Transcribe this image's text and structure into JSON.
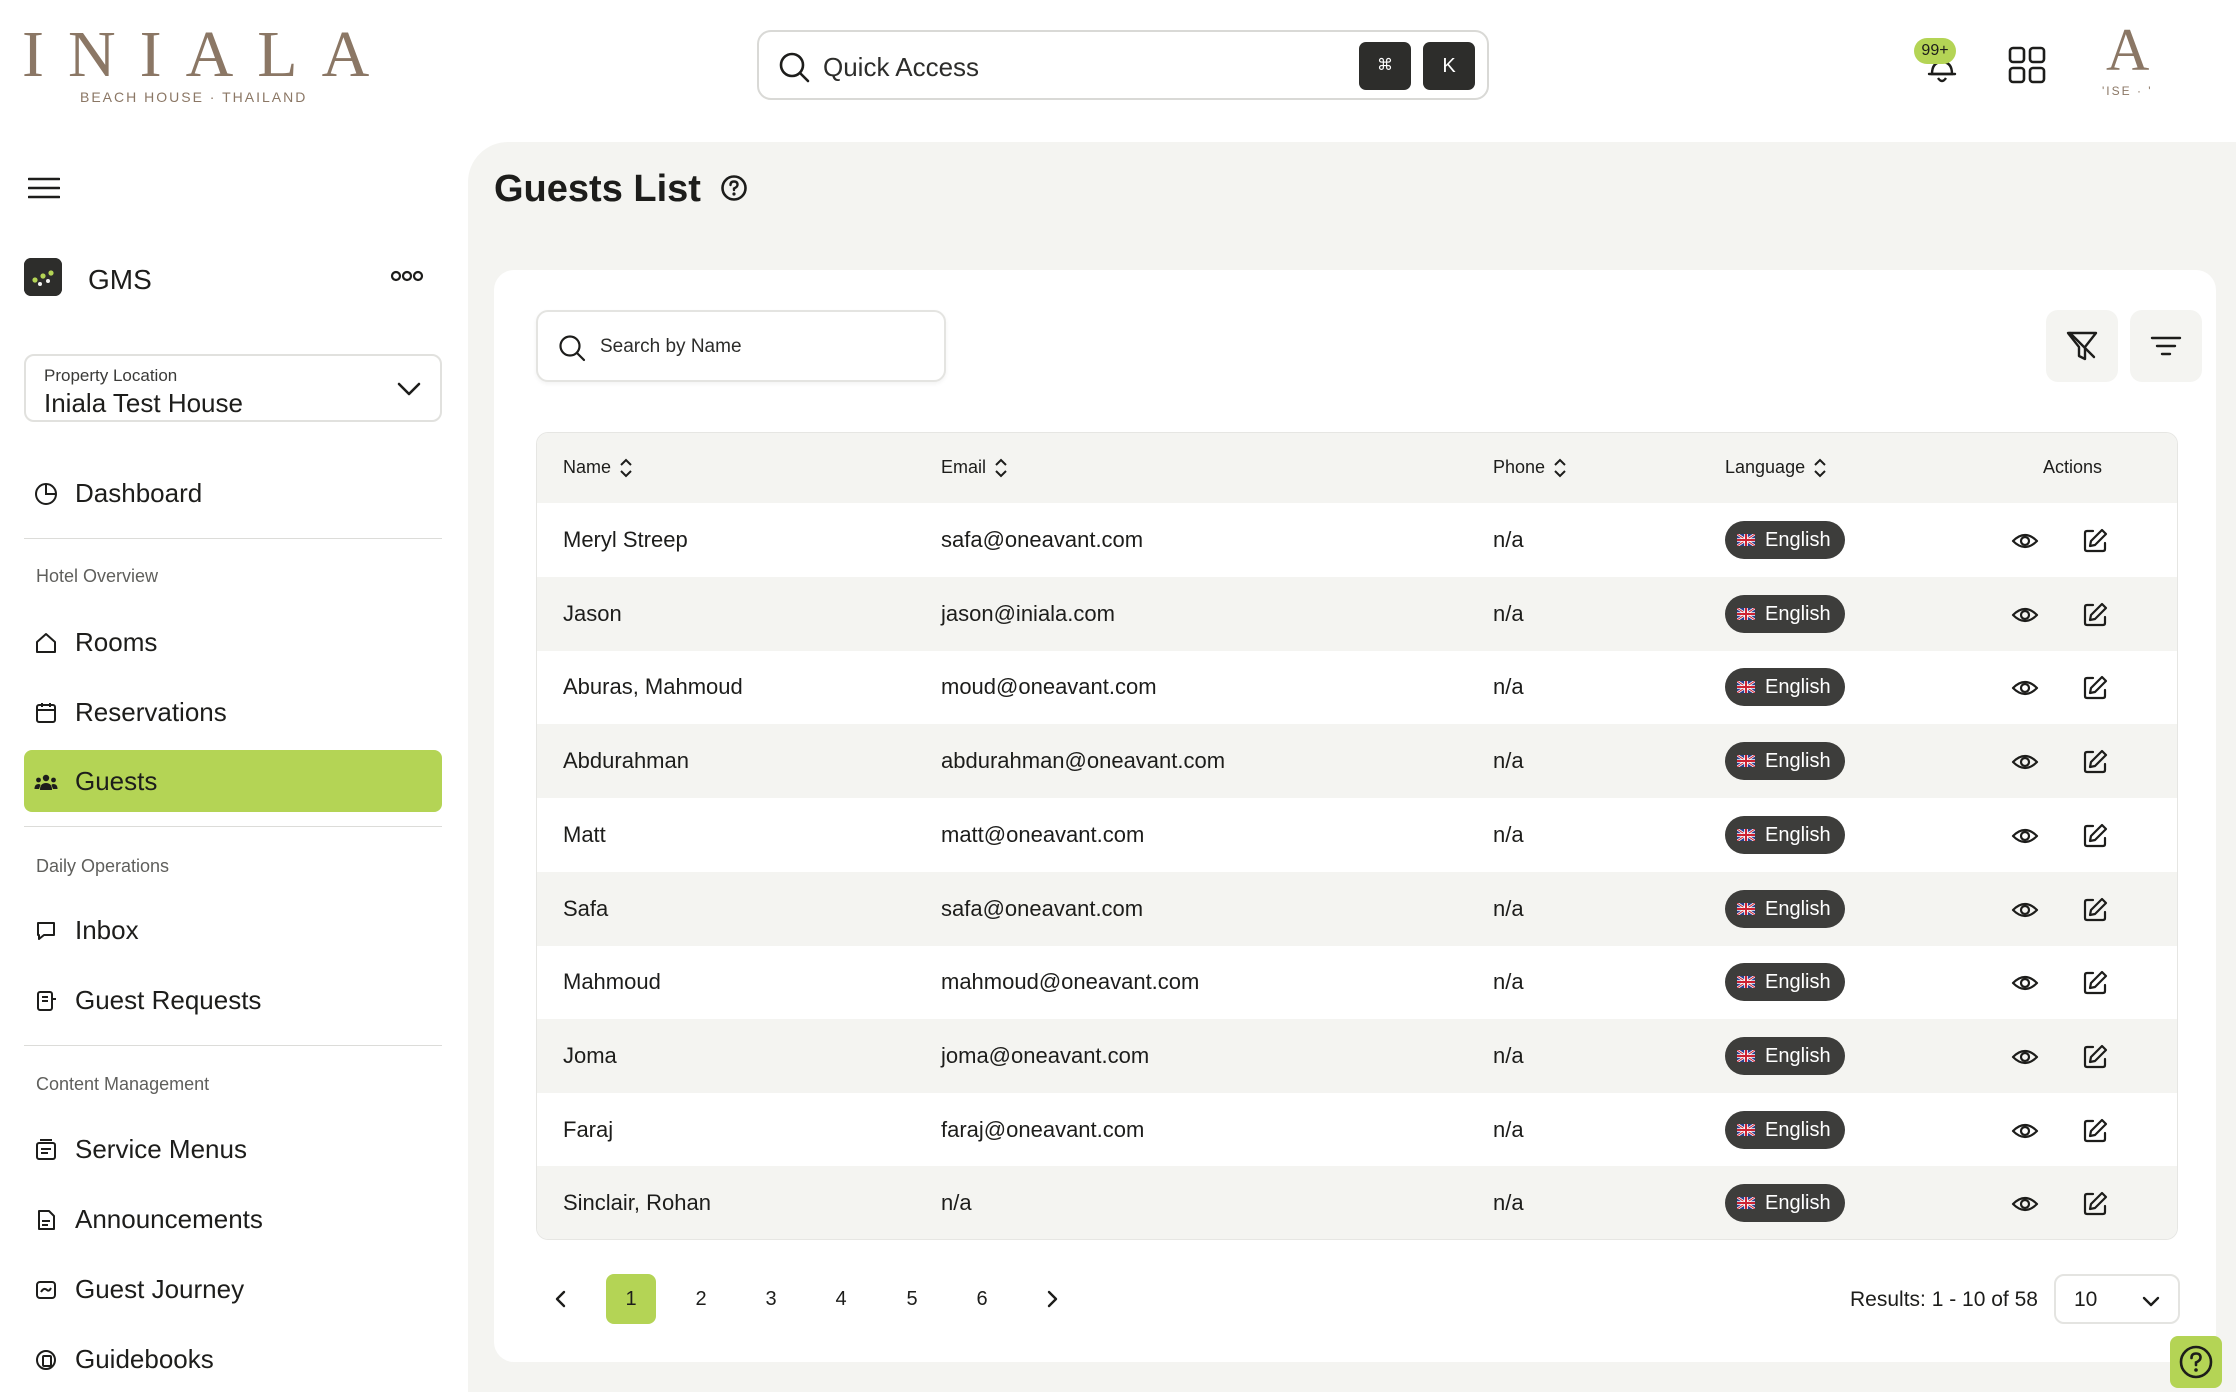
{
  "brand": {
    "name": "INIALA",
    "tagline": "BEACH HOUSE · THAILAND",
    "corner_logo": "A",
    "corner_sub": "'ISE · '"
  },
  "header": {
    "quick_access": {
      "label": "Quick Access",
      "shortcut": [
        "⌘",
        "K"
      ]
    },
    "notifications": {
      "count": "99+",
      "icon": "bell-icon"
    },
    "apps_icon": "grid-icon"
  },
  "sidebar": {
    "app": {
      "name": "GMS"
    },
    "property": {
      "label": "Property Location",
      "value": "Iniala Test House"
    },
    "dashboard": "Dashboard",
    "sections": [
      {
        "title": "Hotel Overview",
        "items": [
          "Rooms",
          "Reservations",
          "Guests"
        ]
      },
      {
        "title": "Daily Operations",
        "items": [
          "Inbox",
          "Guest Requests"
        ]
      },
      {
        "title": "Content Management",
        "items": [
          "Service Menus",
          "Announcements",
          "Guest Journey",
          "Guidebooks"
        ]
      }
    ],
    "active_item": "Guests"
  },
  "main": {
    "title": "Guests List",
    "search": {
      "placeholder": "Search by Name",
      "value": ""
    },
    "table": {
      "columns": [
        "Name",
        "Email",
        "Phone",
        "Language",
        "Actions"
      ],
      "rows": [
        {
          "name": "Meryl Streep",
          "email": "safa@oneavant.com",
          "phone": "n/a",
          "language": "English"
        },
        {
          "name": "Jason",
          "email": "jason@iniala.com",
          "phone": "n/a",
          "language": "English"
        },
        {
          "name": "Aburas, Mahmoud",
          "email": "moud@oneavant.com",
          "phone": "n/a",
          "language": "English"
        },
        {
          "name": "Abdurahman",
          "email": "abdurahman@oneavant.com",
          "phone": "n/a",
          "language": "English"
        },
        {
          "name": "Matt",
          "email": "matt@oneavant.com",
          "phone": "n/a",
          "language": "English"
        },
        {
          "name": "Safa",
          "email": "safa@oneavant.com",
          "phone": "n/a",
          "language": "English"
        },
        {
          "name": "Mahmoud",
          "email": "mahmoud@oneavant.com",
          "phone": "n/a",
          "language": "English"
        },
        {
          "name": "Joma",
          "email": "joma@oneavant.com",
          "phone": "n/a",
          "language": "English"
        },
        {
          "name": "Faraj",
          "email": "faraj@oneavant.com",
          "phone": "n/a",
          "language": "English"
        },
        {
          "name": "Sinclair, Rohan",
          "email": "n/a",
          "phone": "n/a",
          "language": "English"
        }
      ]
    },
    "pagination": {
      "pages": [
        "1",
        "2",
        "3",
        "4",
        "5",
        "6"
      ],
      "current": "1",
      "results": "Results: 1 - 10 of 58",
      "per_page": "10"
    }
  },
  "colors": {
    "accent": "#b4d455",
    "brand": "#8b7765",
    "dark": "#2d2d2b",
    "surface": "#f4f4f1"
  }
}
